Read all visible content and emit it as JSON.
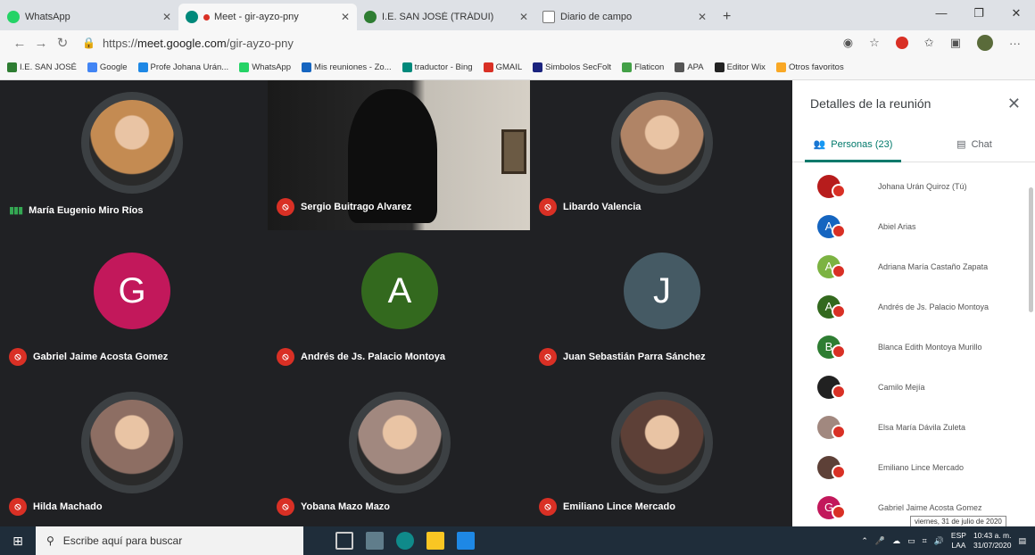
{
  "browser": {
    "tabs": [
      {
        "title": "WhatsApp",
        "color": "#25d366"
      },
      {
        "title": "Meet - gir-ayzo-pny",
        "color": "#00897b"
      },
      {
        "title": "I.E. SAN JOSÉ (TRÁDUI)",
        "color": "#2e7d32"
      },
      {
        "title": "Diario de campo",
        "color": "#777777"
      }
    ],
    "url_scheme": "https://",
    "url_host": "meet.google.com",
    "url_path": "/gir-ayzo-pny",
    "bookmarks": [
      {
        "label": "I.E. SAN JOSÉ",
        "color": "#2e7d32"
      },
      {
        "label": "Google",
        "color": "#4285f4"
      },
      {
        "label": "Profe Johana Urán...",
        "color": "#1e88e5"
      },
      {
        "label": "WhatsApp",
        "color": "#25d366"
      },
      {
        "label": "Mis reuniones - Zo...",
        "color": "#1565c0"
      },
      {
        "label": "traductor - Bing",
        "color": "#00897b"
      },
      {
        "label": "GMAIL",
        "color": "#d93025"
      },
      {
        "label": "Simbolos SecFolt",
        "color": "#1a237e"
      },
      {
        "label": "Flaticon",
        "color": "#43a047"
      },
      {
        "label": "APA",
        "color": "#555555"
      },
      {
        "label": "Editor Wix",
        "color": "#222222"
      },
      {
        "label": "Otros favoritos",
        "color": "#f9a825"
      }
    ]
  },
  "meet": {
    "tiles": [
      {
        "name": "María Eugenio Miro Ríos",
        "kind": "photo",
        "speaking": true,
        "photo_color": "#c48b52"
      },
      {
        "name": "Sergio Buitrago Alvarez",
        "kind": "video",
        "speaking": false
      },
      {
        "name": "Libardo Valencia",
        "kind": "photo",
        "speaking": false,
        "photo_color": "#b08466"
      },
      {
        "name": "Gabriel Jaime Acosta Gomez",
        "kind": "letter",
        "letter": "G",
        "color": "#c2185b"
      },
      {
        "name": "Andrés de Js. Palacio Montoya",
        "kind": "letter",
        "letter": "A",
        "color": "#33691e"
      },
      {
        "name": "Juan Sebastián Parra Sánchez",
        "kind": "letter",
        "letter": "J",
        "color": "#455a64"
      },
      {
        "name": "Hilda Machado",
        "kind": "photo",
        "speaking": false,
        "photo_color": "#8d6e63"
      },
      {
        "name": "Yobana Mazo Mazo",
        "kind": "photo",
        "speaking": false,
        "photo_color": "#a1887f"
      },
      {
        "name": "Emiliano Lince Mercado",
        "kind": "photo",
        "speaking": false,
        "photo_color": "#5d4037"
      }
    ]
  },
  "panel": {
    "title": "Detalles de la reunión",
    "people_tab": "Personas (23)",
    "chat_tab": "Chat",
    "people": [
      {
        "name": "Johana Urán Quiroz (Tú)",
        "letter": "",
        "color": "#b71c1c"
      },
      {
        "name": "Abiel Arias",
        "letter": "A",
        "color": "#1565c0"
      },
      {
        "name": "Adriana María Castaño Zapata",
        "letter": "A",
        "color": "#7cb342"
      },
      {
        "name": "Andrés de Js. Palacio Montoya",
        "letter": "A",
        "color": "#33691e"
      },
      {
        "name": "Blanca Edith Montoya Murillo",
        "letter": "B",
        "color": "#2e7d32"
      },
      {
        "name": "Camilo Mejía",
        "letter": "",
        "color": "#212121"
      },
      {
        "name": "Elsa María Dávila Zuleta",
        "letter": "",
        "color": "#a1887f"
      },
      {
        "name": "Emiliano Lince Mercado",
        "letter": "",
        "color": "#5d4037"
      },
      {
        "name": "Gabriel Jaime Acosta Gomez",
        "letter": "G",
        "color": "#c2185b"
      }
    ]
  },
  "taskbar": {
    "search_placeholder": "Escribe aquí para buscar",
    "lang_top": "ESP",
    "lang_bottom": "LAA",
    "time": "10:43 a. m.",
    "date": "31/07/2020",
    "tooltip": "viernes, 31 de julio de 2020"
  }
}
